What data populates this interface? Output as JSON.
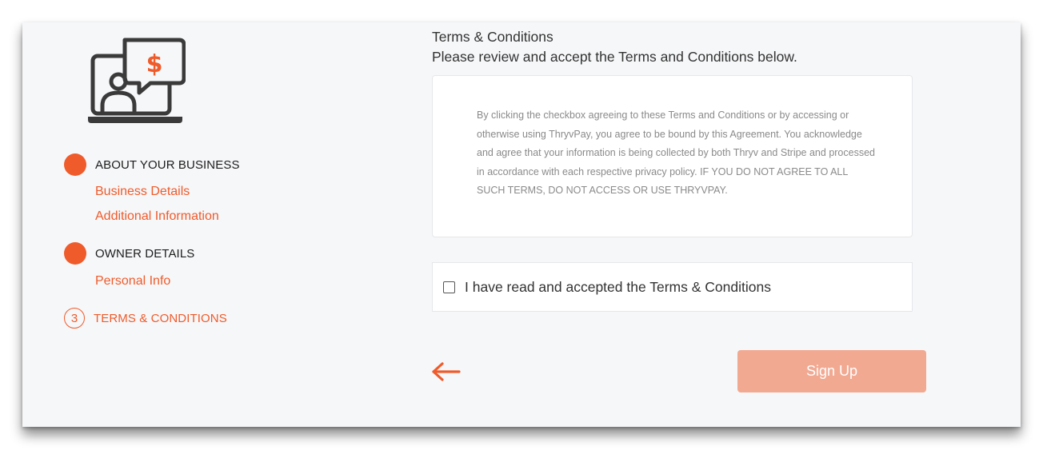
{
  "sidebar": {
    "hero_icon": "laptop-user-dollar-chat-icon",
    "steps": [
      {
        "label": "ABOUT YOUR BUSINESS",
        "status": "completed",
        "links": [
          "Business Details",
          "Additional Information"
        ]
      },
      {
        "label": "OWNER DETAILS",
        "status": "completed",
        "links": [
          "Personal Info"
        ]
      },
      {
        "number": "3",
        "label": "TERMS & CONDITIONS",
        "status": "active",
        "links": []
      }
    ]
  },
  "main": {
    "title": "Terms & Conditions",
    "subtitle": "Please review and accept the Terms and Conditions below.",
    "terms_text": "By clicking the checkbox agreeing to these Terms and Conditions or by accessing or otherwise using ThryvPay, you agree to be bound by this Agreement. You acknowledge and agree that your information is being collected by both Thryv and Stripe and processed in accordance with each respective privacy policy. IF YOU DO NOT AGREE TO ALL SUCH TERMS, DO NOT ACCESS OR USE THRYVPAY.",
    "accept_label": "I have read and accepted the Terms & Conditions",
    "accept_checked": false,
    "back_icon": "arrow-left-icon",
    "signup_label": "Sign Up",
    "signup_enabled": false
  },
  "colors": {
    "accent": "#ef5b2b",
    "accent_disabled": "#f2a992",
    "panel_bg": "#f6f7f9",
    "icon_dark": "#3a3a3a"
  }
}
